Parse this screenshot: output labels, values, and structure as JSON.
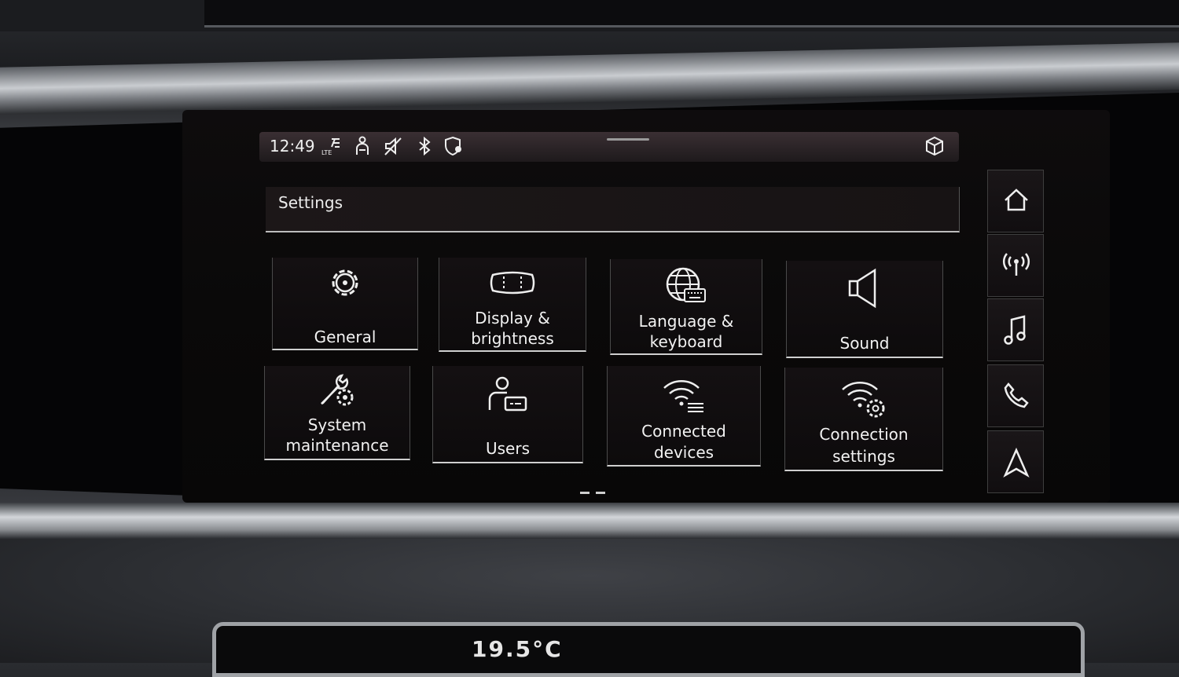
{
  "status_bar": {
    "time": "12:49",
    "icons": [
      "lte-signal-icon",
      "passenger-icon",
      "mute-icon",
      "bluetooth-icon",
      "privacy-location-icon"
    ],
    "right_icon": "cube-icon"
  },
  "header": {
    "title": "Settings"
  },
  "tiles": [
    {
      "label": "General",
      "icon": "gear-icon"
    },
    {
      "label_line1": "Display &",
      "label_line2": "brightness",
      "icon": "display-icon"
    },
    {
      "label_line1": "Language &",
      "label_line2": "keyboard",
      "icon": "globe-keyboard-icon"
    },
    {
      "label": "Sound",
      "icon": "speaker-icon"
    },
    {
      "label_line1": "System",
      "label_line2": "maintenance",
      "icon": "wrench-gear-icon"
    },
    {
      "label": "Users",
      "icon": "user-icon"
    },
    {
      "label_line1": "Connected",
      "label_line2": "devices",
      "icon": "wifi-list-icon"
    },
    {
      "label_line1": "Connection",
      "label_line2": "settings",
      "icon": "wifi-gear-icon"
    }
  ],
  "sidebar": [
    "home-icon",
    "radio-icon",
    "music-icon",
    "phone-icon",
    "navigation-icon"
  ],
  "climate": {
    "temp": "19.5°C"
  },
  "colors": {
    "text": "#f2f2f2",
    "tile_border": "#cfcfcf",
    "bg": "#0a0909"
  }
}
